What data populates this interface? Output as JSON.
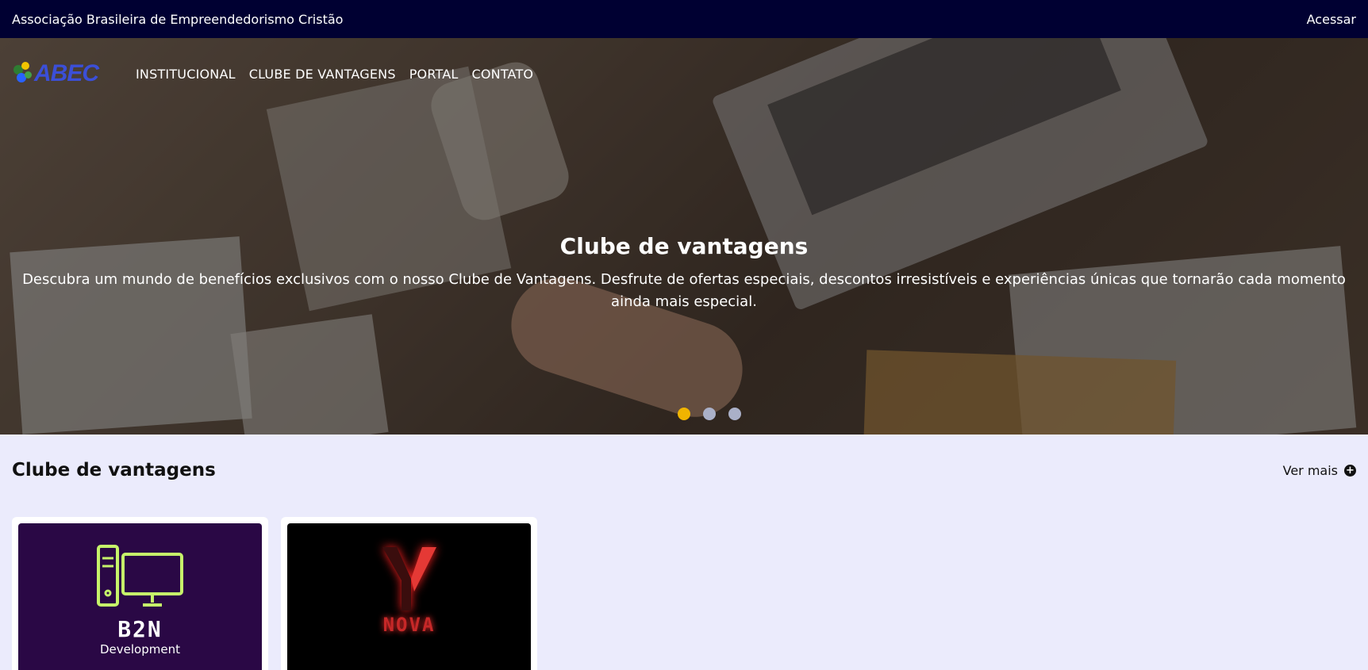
{
  "topbar": {
    "org_name": "Associação Brasileira de Empreendedorismo Cristão",
    "login_label": "Acessar"
  },
  "nav": {
    "logo_text": "ABEC",
    "items": [
      {
        "label": "INSTITUCIONAL"
      },
      {
        "label": "CLUBE DE VANTAGENS"
      },
      {
        "label": "PORTAL"
      },
      {
        "label": "CONTATO"
      }
    ]
  },
  "hero": {
    "title": "Clube de vantagens",
    "text": "Descubra um mundo de benefícios exclusivos com o nosso Clube de Vantagens. Desfrute de ofertas especiais, descontos irresistíveis e experiências únicas que tornarão cada momento ainda mais especial.",
    "slides": 3,
    "active_slide": 1
  },
  "section": {
    "title": "Clube de vantagens",
    "more_label": "Ver mais",
    "more_icon": "plus-circle-icon"
  },
  "cards": [
    {
      "brand": "B2N",
      "subtitle": "Development",
      "bg": "#2a0845",
      "accent": "#c6f36a"
    },
    {
      "brand": "NOVA",
      "bg": "#000000",
      "accent": "#d32f2f"
    }
  ]
}
